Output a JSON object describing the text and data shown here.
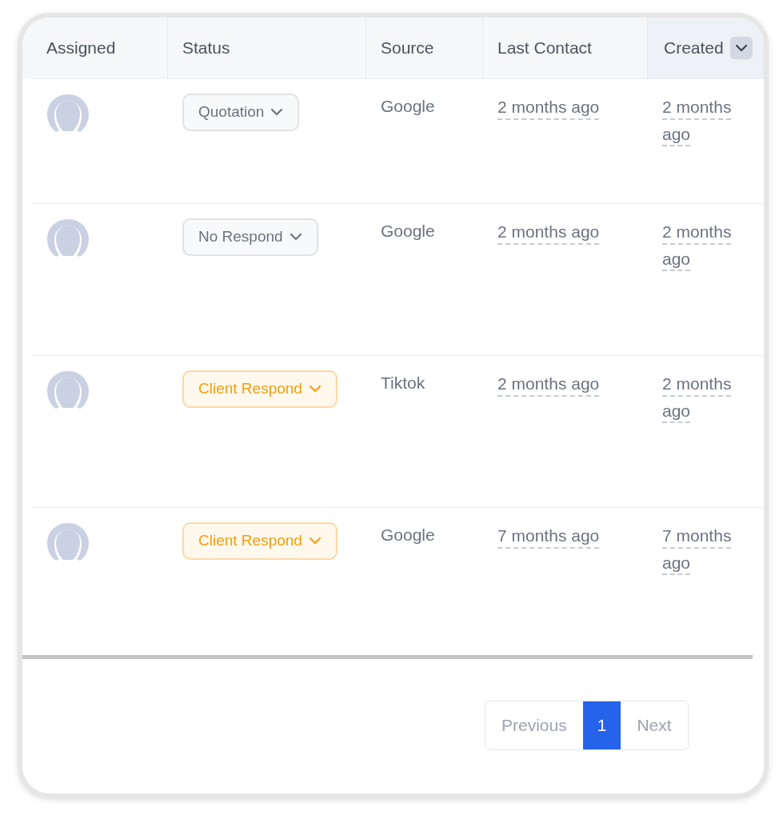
{
  "table": {
    "columns": [
      {
        "label": "Assigned",
        "sorted": false
      },
      {
        "label": "Status",
        "sorted": false
      },
      {
        "label": "Source",
        "sorted": false
      },
      {
        "label": "Last Contact",
        "sorted": false
      },
      {
        "label": "Created",
        "sorted": true
      }
    ],
    "rows": [
      {
        "status": {
          "label": "Quotation",
          "kind": "neutral"
        },
        "source": "Google",
        "last_contact": "2 months ago",
        "created": "2 months ago"
      },
      {
        "status": {
          "label": "No Respond",
          "kind": "neutral"
        },
        "source": "Google",
        "last_contact": "2 months ago",
        "created": "2 months ago"
      },
      {
        "status": {
          "label": "Client Respond",
          "kind": "warning"
        },
        "source": "Tiktok",
        "last_contact": "2 months ago",
        "created": "2 months ago"
      },
      {
        "status": {
          "label": "Client Respond",
          "kind": "warning"
        },
        "source": "Google",
        "last_contact": "7 months ago",
        "created": "7 months ago"
      }
    ]
  },
  "pagination": {
    "previous": "Previous",
    "pages": [
      {
        "label": "1",
        "selected": true
      }
    ],
    "next": "Next"
  }
}
